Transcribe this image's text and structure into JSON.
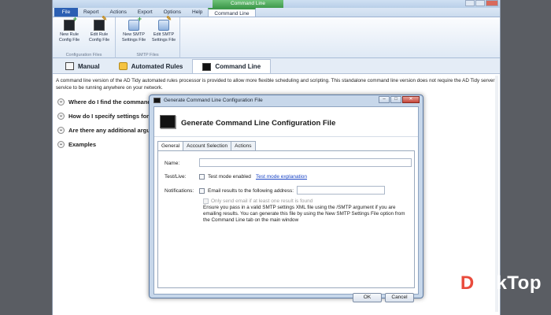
{
  "titlebar": {
    "context_title": "Command Line"
  },
  "ribbon": {
    "file_label": "File",
    "tabs": [
      "Report",
      "Actions",
      "Export",
      "Options",
      "Help",
      "Command Line"
    ],
    "groups": [
      {
        "label": "Configuration Files",
        "buttons": [
          [
            "New Rule",
            "Config File"
          ],
          [
            "Edit Rule",
            "Config File"
          ]
        ]
      },
      {
        "label": "SMTP Files",
        "buttons": [
          [
            "New SMTP",
            "Settings File"
          ],
          [
            "Edit SMTP",
            "Settings File"
          ]
        ]
      }
    ]
  },
  "content_tabs": [
    "Manual",
    "Automated Rules",
    "Command Line"
  ],
  "intro": "A command line version of the AD Tidy automated rules processor is provided to allow more flexible scheduling and scripting. This standalone command line version does not require the AD Tidy server service to be running anywhere on your network.",
  "faq": [
    "Where do I find the command",
    "How do I specify settings for th",
    "Are there any additional argum",
    "Examples"
  ],
  "dialog": {
    "title": "Generate Command Line Configuration File",
    "header": "Generate Command Line Configuration File",
    "tabs": [
      "General",
      "Account Selection",
      "Actions"
    ],
    "name_label": "Name:",
    "name_value": "",
    "testlive_label": "Test/Live:",
    "test_mode_label": "Test mode enabled",
    "test_mode_link": "Test mode explanation",
    "notifications_label": "Notifications:",
    "email_label": "Email results to the following address:",
    "email_value": "",
    "only_send_label": "Only send email if at least one result is found",
    "note": "Ensure you pass in a valid SMTP settings XML file using the /SMTP argument if you are emailing results. You can generate this file by using the New SMTP Settings File option from the Command Line tab on the main window",
    "ok_label": "OK",
    "cancel_label": "Cancel"
  },
  "watermark": {
    "prefix": "D",
    "rest": "eskTop"
  }
}
